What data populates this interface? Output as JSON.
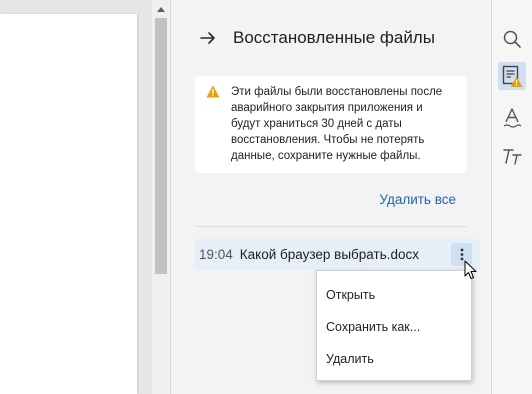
{
  "panel": {
    "title": "Восстановленные файлы",
    "notice": "Эти файлы были восстановлены после аварийного закрытия приложения и будут храниться 30 дней с даты восстановления. Чтобы не потерять данные, сохраните нужные файлы.",
    "delete_all": "Удалить все"
  },
  "file": {
    "time": "19:04",
    "name": "Какой браузер выбрать.docx"
  },
  "context_menu": {
    "items": [
      "Открыть",
      "Сохранить как...",
      "Удалить"
    ]
  },
  "toolbar": {
    "items": [
      "search-icon",
      "recovered-files-icon",
      "text-style-icon",
      "font-icon"
    ]
  },
  "colors": {
    "accent": "#1b65b4",
    "selection": "#e6eef8",
    "active_tool": "#cfe0f4",
    "warning": "#e8a100"
  }
}
